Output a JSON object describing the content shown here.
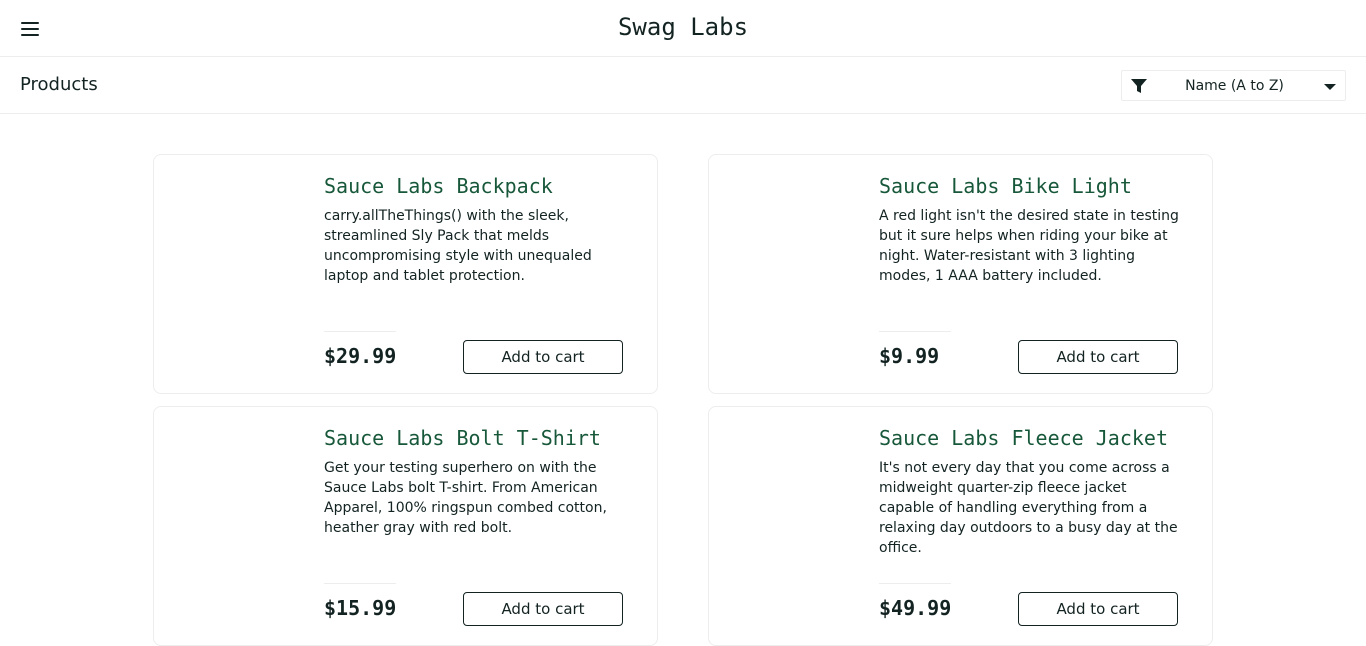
{
  "header": {
    "title": "Swag Labs",
    "menu_icon": "hamburger-menu-icon"
  },
  "subheader": {
    "title": "Products",
    "sort": {
      "selected": "Name (A to Z)",
      "icon": "filter-icon"
    }
  },
  "items": [
    {
      "name": "Sauce Labs Backpack",
      "description": "carry.allTheThings() with the sleek, streamlined Sly Pack that melds uncompromising style with unequaled laptop and tablet protection.",
      "price": "$29.99",
      "button": "Add to cart"
    },
    {
      "name": "Sauce Labs Bike Light",
      "description": "A red light isn't the desired state in testing but it sure helps when riding your bike at night. Water-resistant with 3 lighting modes, 1 AAA battery included.",
      "price": "$9.99",
      "button": "Add to cart"
    },
    {
      "name": "Sauce Labs Bolt T-Shirt",
      "description": "Get your testing superhero on with the Sauce Labs bolt T-shirt. From American Apparel, 100% ringspun combed cotton, heather gray with red bolt.",
      "price": "$15.99",
      "button": "Add to cart"
    },
    {
      "name": "Sauce Labs Fleece Jacket",
      "description": "It's not every day that you come across a midweight quarter-zip fleece jacket capable of handling everything from a relaxing day outdoors to a busy day at the office.",
      "price": "$49.99",
      "button": "Add to cart"
    }
  ],
  "colors": {
    "item_name": "#18583a",
    "text": "#132322",
    "border": "#ededed"
  }
}
